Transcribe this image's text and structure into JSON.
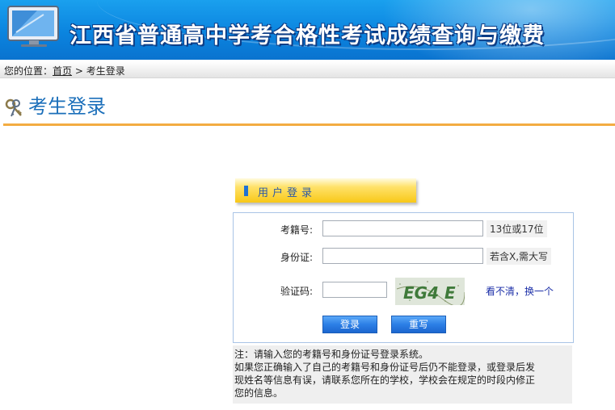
{
  "header": {
    "title": "江西省普通高中学考合格性考试成绩查询与缴费"
  },
  "breadcrumb": {
    "prefix": "您的位置：",
    "home": "首页",
    "separator": " > ",
    "current": "考生登录"
  },
  "section": {
    "title": "考生登录"
  },
  "login": {
    "tab_label": "用户登录",
    "fields": {
      "exam_no": {
        "label": "考籍号:",
        "value": "",
        "hint": "13位或17位"
      },
      "id_no": {
        "label": "身份证:",
        "value": "",
        "hint": "若含X,需大写"
      },
      "captcha": {
        "label": "验证码:",
        "value": "",
        "image_text": "EG4 E",
        "refresh": "看不清，换一个"
      }
    },
    "buttons": {
      "login": "登录",
      "reset": "重写"
    }
  },
  "note": {
    "line1": "注：请输入您的考籍号和身份证号登录系统。",
    "line2": "如果您正确输入了自己的考籍号和身份证号后仍不能登录，或登录后发",
    "line3": "现姓名等信息有误，请联系您所在的学校，学校会在规定的时段内修正",
    "line4": "您的信息。"
  },
  "colors": {
    "banner": "#0b84df",
    "title_blue": "#1b6fba",
    "divider_orange": "#f3ac42",
    "button_blue": "#2c7fe6",
    "link_blue": "#1c2fa8"
  }
}
